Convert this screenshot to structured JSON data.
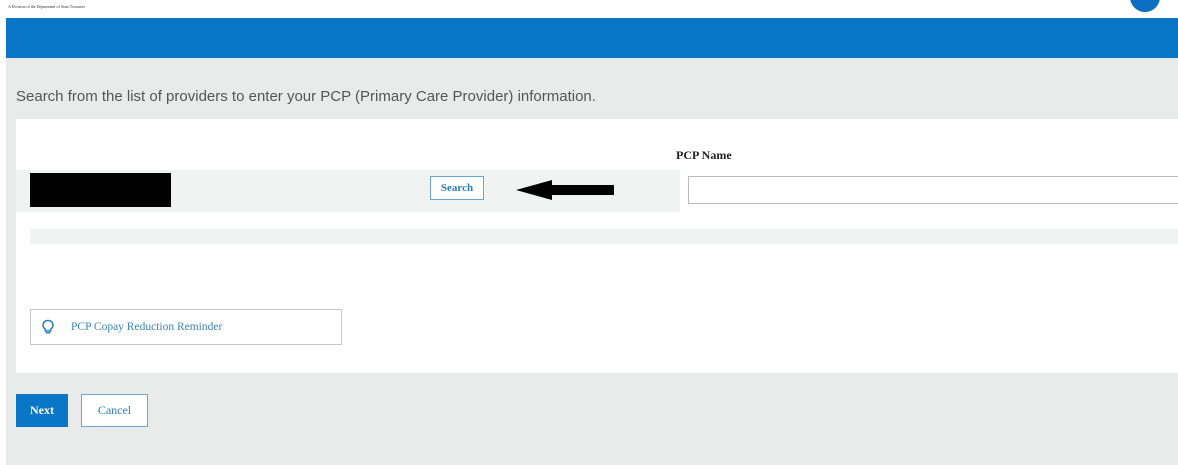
{
  "header": {
    "tagline": "A Division of the Department of State Treasurer"
  },
  "main": {
    "instructions": "Search from the list of providers to enter your PCP (Primary Care Provider) information.",
    "pcp_name_label": "PCP Name",
    "pcp_name_value": "",
    "search_label": "Search",
    "reminder_label": "PCP Copay Reduction Reminder"
  },
  "footer": {
    "next_label": "Next",
    "cancel_label": "Cancel"
  },
  "colors": {
    "brand_blue": "#0a76c7",
    "link_blue": "#2e7fb8",
    "page_gray": "#e9eaea"
  },
  "icons": {
    "reminder": "lightbulb-icon",
    "pointer": "arrow-left-icon"
  }
}
